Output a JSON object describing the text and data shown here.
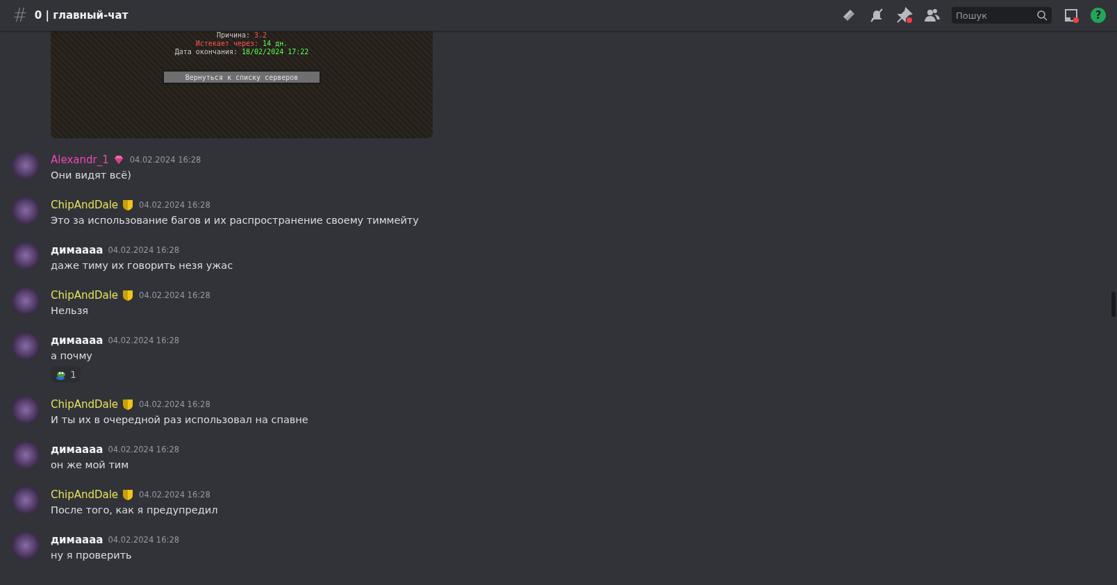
{
  "header": {
    "hash": "#",
    "channel": "0 | главный-чат",
    "search": {
      "placeholder": "Пошук"
    },
    "help": "?"
  },
  "embed": {
    "lines": [
      [
        {
          "text": "Причина: ",
          "kind": "label"
        },
        {
          "text": "3.2",
          "kind": "alert"
        }
      ],
      [
        {
          "text": "Истекает через: ",
          "kind": "alert"
        },
        {
          "text": "14 дн.",
          "kind": "good"
        }
      ],
      [
        {
          "text": "Дата окончания: ",
          "kind": "label"
        },
        {
          "text": "18/02/2024 17:22",
          "kind": "good"
        }
      ]
    ],
    "button": "Вернуться к списку серверов"
  },
  "messages": [
    {
      "author": "Alexandr_1",
      "color": "#f047b4",
      "badge": {
        "kind": "gem"
      },
      "time": "04.02.2024 16:28",
      "text": "Они видят всё)"
    },
    {
      "author": "ChipAndDale",
      "color": "#e6e35c",
      "badge": {
        "kind": "shield"
      },
      "time": "04.02.2024 16:28",
      "text": "Это за использование багов и их распространение своему тиммейту"
    },
    {
      "author": "димаааа",
      "color": "#f2f3f5",
      "time": "04.02.2024 16:28",
      "text": "даже тиму их говорить незя ужас"
    },
    {
      "author": "ChipAndDale",
      "color": "#e6e35c",
      "badge": {
        "kind": "shield"
      },
      "time": "04.02.2024 16:28",
      "text": "Нельзя"
    },
    {
      "author": "димаааа",
      "color": "#f2f3f5",
      "time": "04.02.2024 16:28",
      "text": "а почму",
      "reactions": [
        {
          "count": "1"
        }
      ]
    },
    {
      "author": "ChipAndDale",
      "color": "#e6e35c",
      "badge": {
        "kind": "shield"
      },
      "time": "04.02.2024 16:28",
      "text": "И ты их в очередной раз использовал на спавне"
    },
    {
      "author": "димаааа",
      "color": "#f2f3f5",
      "time": "04.02.2024 16:28",
      "text": "он же мой тим"
    },
    {
      "author": "ChipAndDale",
      "color": "#e6e35c",
      "badge": {
        "kind": "shield"
      },
      "time": "04.02.2024 16:28",
      "text": "После того, как я предупредил"
    },
    {
      "author": "димаааа",
      "color": "#f2f3f5",
      "time": "04.02.2024 16:28",
      "text": "ну я проверить"
    }
  ]
}
